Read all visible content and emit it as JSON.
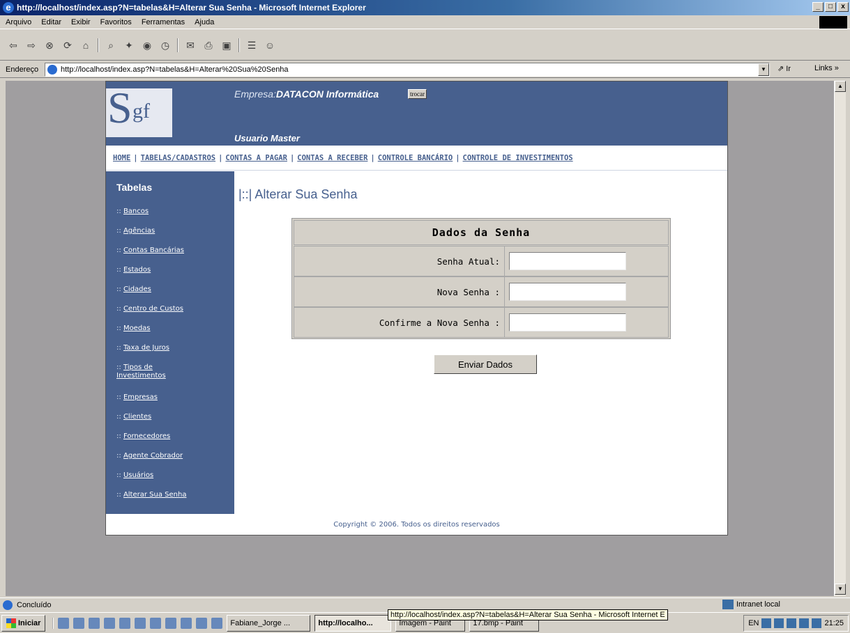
{
  "window": {
    "title": "http://localhost/index.asp?N=tabelas&H=Alterar Sua Senha - Microsoft Internet Explorer",
    "min": "_",
    "max": "□",
    "close": "x"
  },
  "menu": [
    "Arquivo",
    "Editar",
    "Exibir",
    "Favoritos",
    "Ferramentas",
    "Ajuda"
  ],
  "toolbar_icons": [
    "back-icon",
    "forward-icon",
    "stop-icon",
    "refresh-icon",
    "home-icon",
    "search-icon",
    "favorites-icon",
    "media-icon",
    "history-icon",
    "mail-icon",
    "print-icon",
    "edit-icon",
    "discuss-icon",
    "messenger-icon"
  ],
  "address": {
    "label": "Endereço",
    "url": "http://localhost/index.asp?N=tabelas&H=Alterar%20Sua%20Senha",
    "go": "Ir",
    "links": "Links"
  },
  "site": {
    "logo_s": "S",
    "logo_gf": "gf",
    "empresa_label": "Empresa:",
    "empresa_name": "DATACON Informática",
    "trocar": "trocar",
    "usuario": "Usuario Master",
    "nav": [
      "HOME",
      "TABELAS/CADASTROS",
      "CONTAS A PAGAR",
      "CONTAS A RECEBER",
      "CONTROLE BANCÁRIO",
      "CONTROLE DE INVESTIMENTOS"
    ],
    "sidebar_title": "Tabelas",
    "sidebar_prefix": "::",
    "sidebar_items": [
      "Bancos",
      "Agências",
      "Contas Bancárias",
      "Estados",
      "Cidades",
      "Centro de Custos",
      "Moedas",
      "Taxa de Juros",
      "Tipos de Investimentos",
      "Empresas",
      "Clientes",
      "Fornecedores",
      "Agente Cobrador",
      "Usuários",
      "Alterar Sua Senha"
    ],
    "page_title": "|::| Alterar Sua Senha",
    "form": {
      "header": "Dados da Senha",
      "fields": [
        {
          "label": "Senha Atual:",
          "value": ""
        },
        {
          "label": "Nova Senha :",
          "value": ""
        },
        {
          "label": "Confirme a Nova Senha :",
          "value": ""
        }
      ],
      "submit": "Enviar Dados"
    },
    "footer": "Copyright © 2006. Todos os direitos reservados"
  },
  "status": {
    "text": "Concluído",
    "zone": "Intranet local"
  },
  "taskbar": {
    "start": "Iniciar",
    "tasks": [
      "Fabiane_Jorge ...",
      "http://localho...",
      "Imagem - Paint",
      "17.bmp - Paint"
    ],
    "active_task": 1,
    "tooltip": "http://localhost/index.asp?N=tabelas&H=Alterar Sua Senha - Microsoft Internet E",
    "lang": "EN",
    "clock": "21:25"
  }
}
